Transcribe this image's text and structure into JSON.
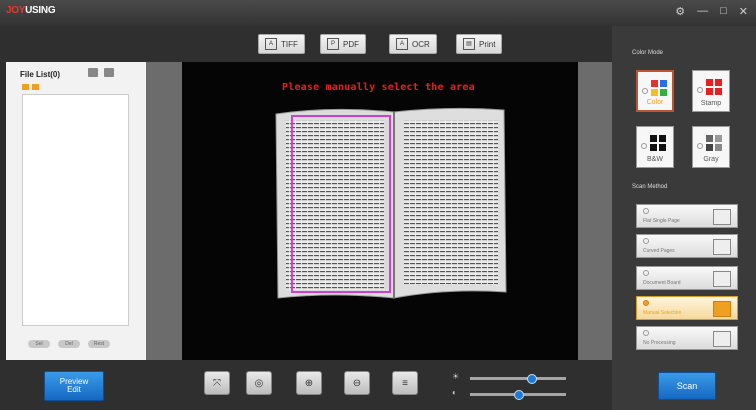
{
  "titlebar": {
    "logo_prefix": "JOY",
    "logo_suffix": "USING",
    "window_controls": [
      "⚙",
      "—",
      "□",
      "✕"
    ]
  },
  "toolbar": {
    "buttons": [
      {
        "label": "TIFF",
        "icon": "tiff-icon"
      },
      {
        "label": "PDF",
        "icon": "pdf-icon"
      },
      {
        "label": "OCR",
        "icon": "ocr-icon"
      },
      {
        "label": "Print",
        "icon": "printer-icon"
      }
    ]
  },
  "file_list": {
    "title": "File List(0)",
    "footer_buttons": [
      "Sel",
      "Del",
      "Rest"
    ]
  },
  "preview": {
    "hint": "Please manually select the area"
  },
  "color_mode": {
    "title": "Color Mode",
    "options": [
      {
        "label": "Color",
        "selected": true
      },
      {
        "label": "Stamp",
        "selected": false
      },
      {
        "label": "B&W",
        "selected": false
      },
      {
        "label": "Gray",
        "selected": false
      }
    ]
  },
  "scan_method": {
    "title": "Scan Method",
    "options": [
      {
        "label": "Flat Single Page",
        "selected": false
      },
      {
        "label": "Curved Pages",
        "selected": false
      },
      {
        "label": "Document Board",
        "selected": false
      },
      {
        "label": "Manual Selection",
        "selected": true
      },
      {
        "label": "No Processing",
        "selected": false
      }
    ]
  },
  "bottom": {
    "preview_edit_label": "Preview\nEdit",
    "scan_label": "Scan",
    "tools": [
      "fit-screen-icon",
      "actual-size-icon",
      "zoom-in-icon",
      "zoom-out-icon",
      "settings-sliders-icon"
    ],
    "slider_brightness": 0.65,
    "slider_contrast": 0.5
  },
  "colors": {
    "accent_blue": "#1d7bd8",
    "hint_red": "#e62020",
    "selection_magenta": "#d040d0"
  }
}
